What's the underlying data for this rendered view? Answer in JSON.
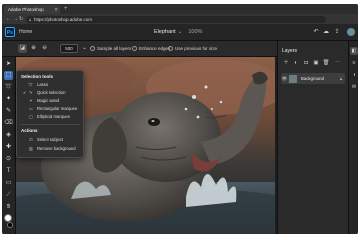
{
  "browser": {
    "tab_title": "Adobe Photoshop",
    "url": "https://photoshop.adobe.com"
  },
  "app": {
    "logo_text": "Ps",
    "home_label": "Home",
    "document_name": "Elephant",
    "zoom": "100%"
  },
  "options_bar": {
    "brush_size": "500",
    "sample_all_layers": "Sample all layers",
    "enhance_edges": "Enhance edges",
    "use_previous_for_size": "Use previous for size"
  },
  "flyout": {
    "selection_tools_header": "Selection tools",
    "selection_tools": [
      {
        "label": "Lasso",
        "checked": false
      },
      {
        "label": "Quick selection",
        "checked": true
      },
      {
        "label": "Magic wand",
        "checked": false
      },
      {
        "label": "Rectangular marquee",
        "checked": false
      },
      {
        "label": "Elliptical marquee",
        "checked": false
      }
    ],
    "actions_header": "Actions",
    "actions": [
      {
        "label": "Select subject"
      },
      {
        "label": "Remove background"
      }
    ]
  },
  "layers_panel": {
    "title": "Layers",
    "layers": [
      {
        "name": "Background",
        "locked": true
      }
    ]
  },
  "colors": {
    "accent": "#31a8ff",
    "selected_tool": "#3d6fb6",
    "foreground_swatch": "#ffffff",
    "background_swatch": "#000000"
  }
}
